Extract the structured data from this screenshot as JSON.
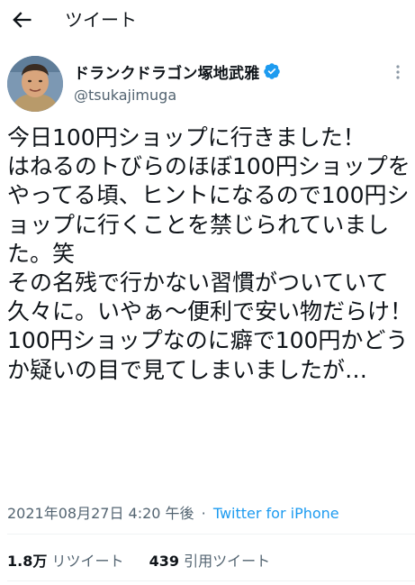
{
  "header": {
    "title": "ツイート"
  },
  "user": {
    "display_name": "ドランクドラゴン塚地武雅",
    "handle": "@tsukajimuga",
    "verified_color": "#1d9bf0"
  },
  "tweet": {
    "text": "今日100円ショップに行きました！\nはねるのトびらのほぼ100円ショップをやってる頃、ヒントになるので100円ショップに行くことを禁じられていました。笑\nその名残で行かない習慣がついていて久々に。いやぁ〜便利で安い物だらけ！\n100円ショップなのに癖で100円かどうか疑いの目で見てしまいましたが…",
    "timestamp": "2021年08月27日 4:20 午後",
    "separator": "·",
    "source": "Twitter for iPhone"
  },
  "stats": {
    "retweets_count": "1.8万",
    "retweets_label": "リツイート",
    "quotes_count": "439",
    "quotes_label": "引用ツイート"
  },
  "colors": {
    "accent": "#1d9bf0",
    "secondary_text": "#536471",
    "text": "#0f1419"
  },
  "icons": {
    "back": "arrow-left-icon",
    "more": "more-vertical-icon",
    "verified": "verified-badge-icon"
  }
}
